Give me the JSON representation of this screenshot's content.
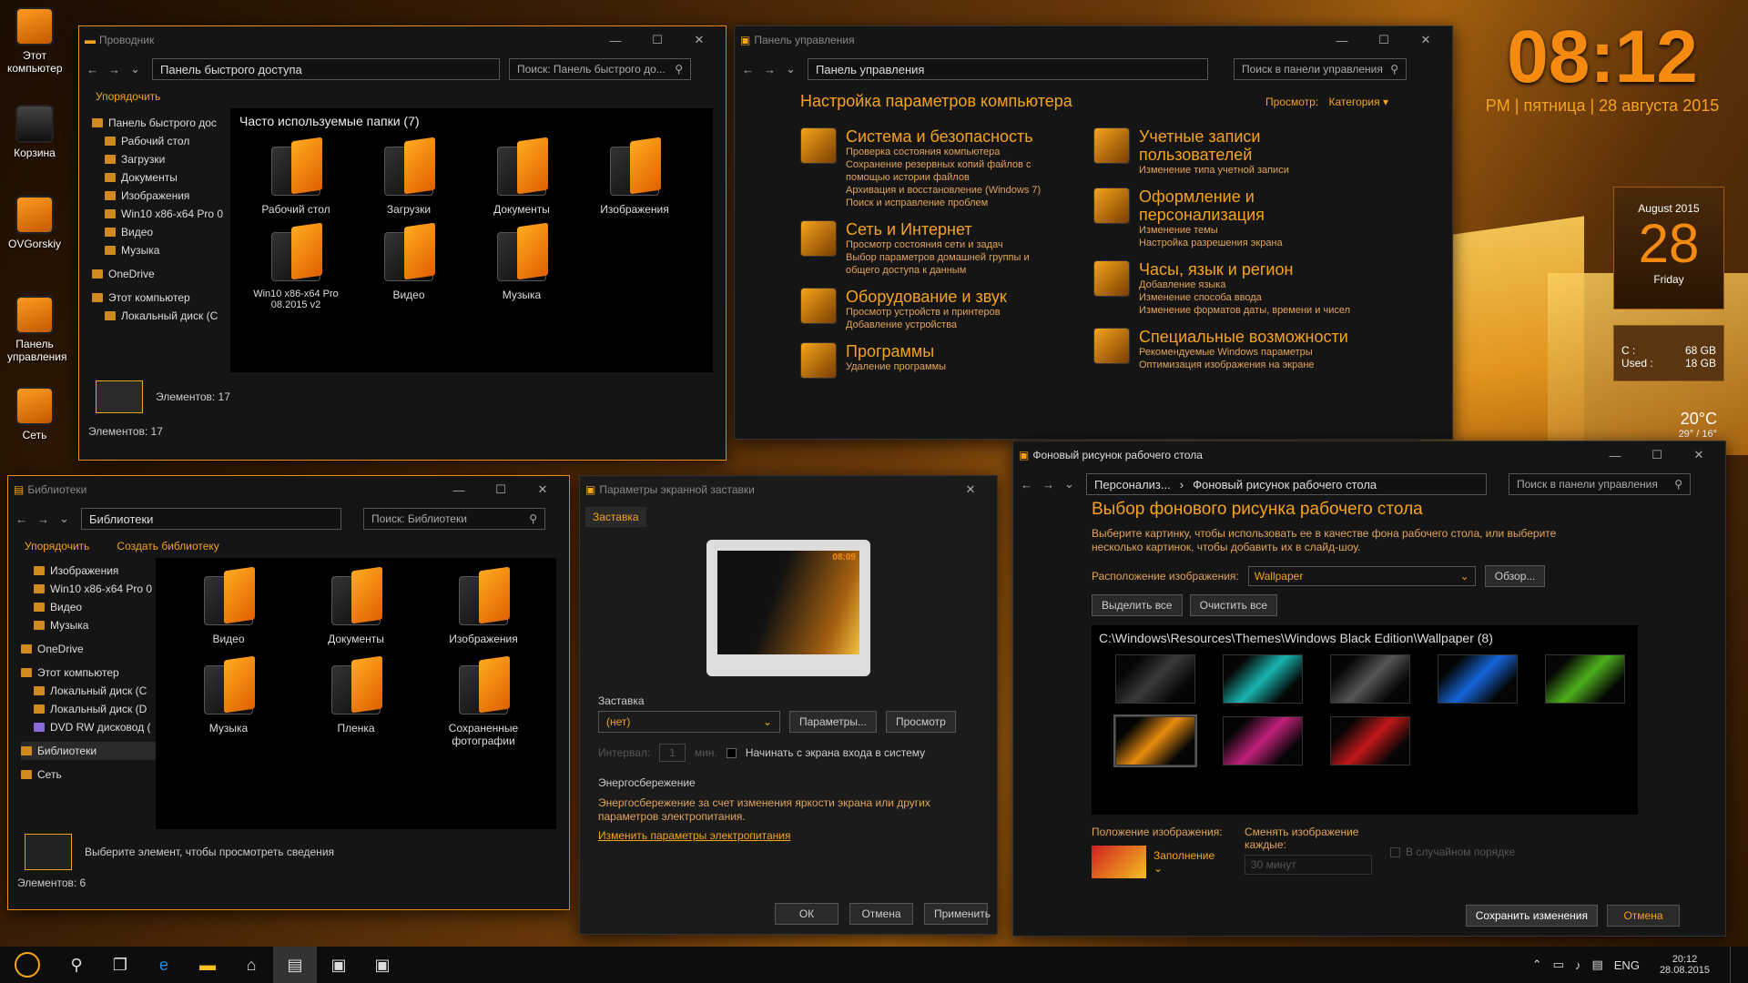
{
  "desktop": {
    "icons": [
      {
        "label": "Этот компьютер"
      },
      {
        "label": "Корзина"
      },
      {
        "label": "OVGorskiy"
      },
      {
        "label": "Панель управления"
      },
      {
        "label": "Сеть"
      }
    ]
  },
  "clock": {
    "time": "08:12",
    "date": "PM | пятница | 28 августа 2015"
  },
  "calendar": {
    "month": "August 2015",
    "day": "28",
    "weekday": "Friday"
  },
  "drive": {
    "c_label": "C :",
    "c_val": "68 GB",
    "used_label": "Used :",
    "used_val": "18 GB"
  },
  "weather": {
    "temp": "20°C",
    "range": "29° / 16°"
  },
  "explorer": {
    "title": "Проводник",
    "address": "Панель быстрого доступа",
    "search": "Поиск: Панель быстрого до...",
    "organize": "Упорядочить",
    "section": "Часто используемые папки (7)",
    "tree": [
      "Панель быстрого дос",
      "Рабочий стол",
      "Загрузки",
      "Документы",
      "Изображения",
      "Win10 x86-x64 Pro 0",
      "Видео",
      "Музыка",
      "OneDrive",
      "Этот компьютер",
      "Локальный диск (C"
    ],
    "folders": [
      "Рабочий стол",
      "Загрузки",
      "Документы",
      "Изображения",
      "Win10 x86-x64 Pro 08.2015 v2",
      "Видео",
      "Музыка"
    ],
    "details": "Элементов: 17",
    "status": "Элементов: 17"
  },
  "controlpanel": {
    "title": "Панель управления",
    "address": "Панель управления",
    "search": "Поиск в панели управления",
    "heading": "Настройка параметров компьютера",
    "view_label": "Просмотр:",
    "view_value": "Категория",
    "left": [
      {
        "title": "Система и безопасность",
        "links": [
          "Проверка состояния компьютера",
          "Сохранение резервных копий файлов с помощью истории файлов",
          "Архивация и восстановление (Windows 7)",
          "Поиск и исправление проблем"
        ]
      },
      {
        "title": "Сеть и Интернет",
        "links": [
          "Просмотр состояния сети и задач",
          "Выбор параметров домашней группы и общего доступа к данным"
        ]
      },
      {
        "title": "Оборудование и звук",
        "links": [
          "Просмотр устройств и принтеров",
          "Добавление устройства"
        ]
      },
      {
        "title": "Программы",
        "links": [
          "Удаление программы"
        ]
      }
    ],
    "right": [
      {
        "title": "Учетные записи пользователей",
        "links": [
          "Изменение типа учетной записи"
        ]
      },
      {
        "title": "Оформление и персонализация",
        "links": [
          "Изменение темы",
          "Настройка разрешения экрана"
        ]
      },
      {
        "title": "Часы, язык и регион",
        "links": [
          "Добавление языка",
          "Изменение способа ввода",
          "Изменение форматов даты, времени и чисел"
        ]
      },
      {
        "title": "Специальные возможности",
        "links": [
          "Рекомендуемые Windows параметры",
          "Оптимизация изображения на экране"
        ]
      }
    ]
  },
  "libraries": {
    "title": "Библиотеки",
    "address": "Библиотеки",
    "search": "Поиск: Библиотеки",
    "organize": "Упорядочить",
    "create": "Создать библиотеку",
    "tree": [
      "Изображения",
      "Win10 x86-x64 Pro 0",
      "Видео",
      "Музыка",
      "OneDrive",
      "Этот компьютер",
      "Локальный диск (C",
      "Локальный диск (D",
      "DVD RW дисковод (",
      "Библиотеки",
      "Сеть"
    ],
    "folders": [
      "Видео",
      "Документы",
      "Изображения",
      "Музыка",
      "Пленка",
      "Сохраненные фотографии"
    ],
    "details": "Выберите элемент, чтобы просмотреть сведения",
    "status": "Элементов: 6"
  },
  "screensaver": {
    "title": "Параметры экранной заставки",
    "tab": "Заставка",
    "preview_time": "08:09",
    "group": "Заставка",
    "select": "(нет)",
    "params": "Параметры...",
    "preview": "Просмотр",
    "interval_label": "Интервал:",
    "interval": "1",
    "minutes": "мин.",
    "logon": "Начинать с экрана входа в систему",
    "power_group": "Энергосбережение",
    "power_text": "Энергосбережение за счет изменения яркости экрана или других параметров электропитания.",
    "power_link": "Изменить параметры электропитания",
    "ok": "ОК",
    "cancel": "Отмена",
    "apply": "Применить"
  },
  "wallpaper": {
    "title": "Фоновый рисунок рабочего стола",
    "crumb1": "Персонализ...",
    "crumb2": "Фоновый рисунок рабочего стола",
    "search": "Поиск в панели управления",
    "heading": "Выбор фонового рисунка рабочего стола",
    "desc": "Выберите картинку, чтобы использовать ее в качестве фона рабочего стола, или выберите несколько картинок, чтобы добавить их в слайд-шоу.",
    "loc_label": "Расположение изображения:",
    "loc_value": "Wallpaper",
    "browse": "Обзор...",
    "select_all": "Выделить все",
    "clear_all": "Очистить все",
    "folder": "C:\\Windows\\Resources\\Themes\\Windows Black Edition\\Wallpaper (8)",
    "thumbs": [
      "#3a3a3a",
      "#1ab5b0",
      "#555555",
      "#1565d8",
      "#4caf1a",
      "#e88a10",
      "#c0207a",
      "#c01818"
    ],
    "pos_label": "Положение изображения:",
    "pos_value": "Заполнение",
    "change_label": "Сменять изображение каждые:",
    "change_value": "30 минут",
    "shuffle": "В случайном порядке",
    "save": "Сохранить изменения",
    "cancel": "Отмена"
  },
  "taskbar": {
    "lang": "ENG",
    "time": "20:12",
    "date": "28.08.2015"
  }
}
